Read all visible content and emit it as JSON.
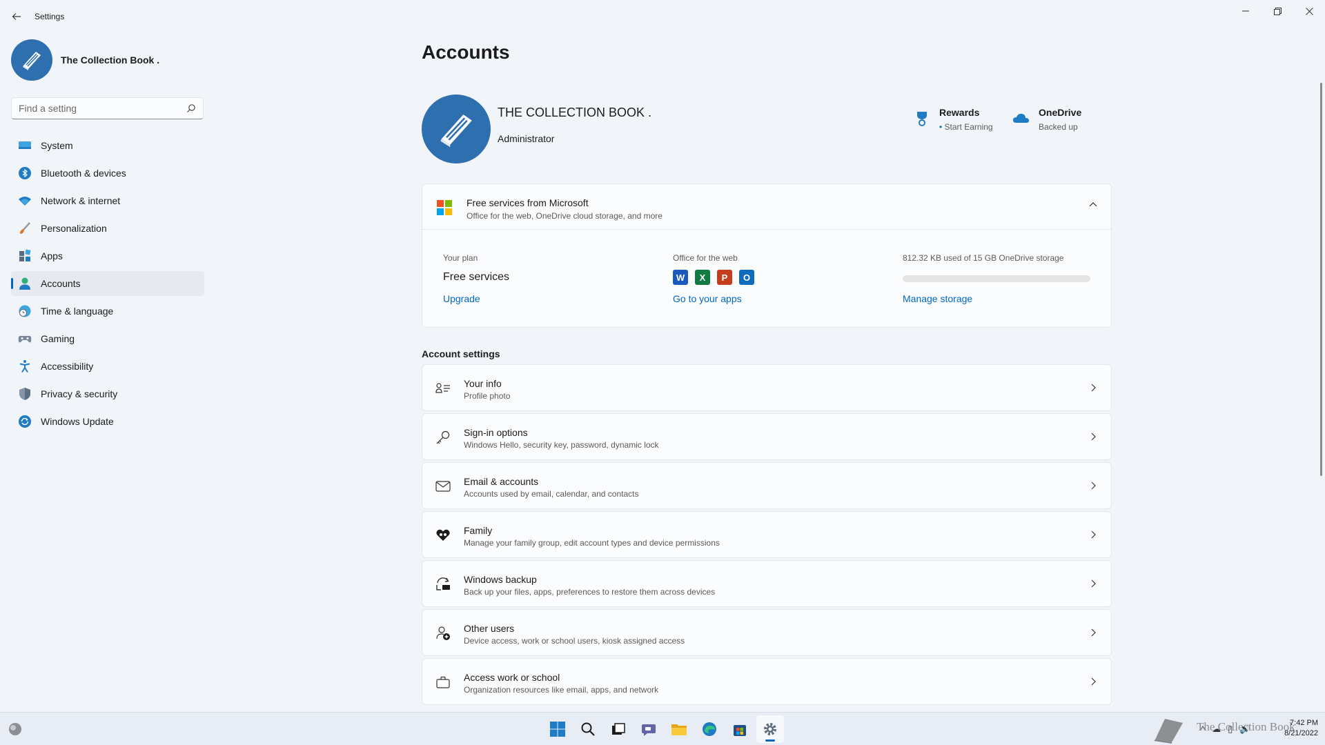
{
  "window": {
    "title": "Settings"
  },
  "profile": {
    "name": "The Collection Book ."
  },
  "search": {
    "placeholder": "Find a setting"
  },
  "nav": [
    {
      "label": "System",
      "icon": "monitor-icon"
    },
    {
      "label": "Bluetooth & devices",
      "icon": "bluetooth-icon"
    },
    {
      "label": "Network & internet",
      "icon": "wifi-icon"
    },
    {
      "label": "Personalization",
      "icon": "brush-icon"
    },
    {
      "label": "Apps",
      "icon": "apps-icon"
    },
    {
      "label": "Accounts",
      "icon": "person-icon",
      "active": true
    },
    {
      "label": "Time & language",
      "icon": "globe-clock-icon"
    },
    {
      "label": "Gaming",
      "icon": "gamepad-icon"
    },
    {
      "label": "Accessibility",
      "icon": "accessibility-icon"
    },
    {
      "label": "Privacy & security",
      "icon": "shield-icon"
    },
    {
      "label": "Windows Update",
      "icon": "update-icon"
    }
  ],
  "main": {
    "page_title": "Accounts",
    "account_name": "THE COLLECTION BOOK .",
    "account_role": "Administrator",
    "rewards": {
      "title": "Rewards",
      "subtitle": "Start Earning"
    },
    "onedrive": {
      "title": "OneDrive",
      "subtitle": "Backed up"
    },
    "free_services": {
      "title": "Free services from Microsoft",
      "subtitle": "Office for the web, OneDrive cloud storage, and more",
      "plan_label": "Your plan",
      "plan_value": "Free services",
      "plan_link": "Upgrade",
      "office_label": "Office for the web",
      "office_link": "Go to your apps",
      "storage_label": "812.32 KB used of 15 GB OneDrive storage",
      "storage_used_fraction": 0.0001,
      "storage_link": "Manage storage",
      "office_apps": [
        {
          "letter": "W",
          "color": "#185abd"
        },
        {
          "letter": "X",
          "color": "#107c41"
        },
        {
          "letter": "P",
          "color": "#c43e1c"
        },
        {
          "letter": "O",
          "color": "#0f6cbd"
        }
      ]
    },
    "section_title": "Account settings",
    "settings": [
      {
        "title": "Your info",
        "subtitle": "Profile photo",
        "icon": "person-card-icon"
      },
      {
        "title": "Sign-in options",
        "subtitle": "Windows Hello, security key, password, dynamic lock",
        "icon": "key-icon"
      },
      {
        "title": "Email & accounts",
        "subtitle": "Accounts used by email, calendar, and contacts",
        "icon": "mail-icon"
      },
      {
        "title": "Family",
        "subtitle": "Manage your family group, edit account types and device permissions",
        "icon": "heart-family-icon"
      },
      {
        "title": "Windows backup",
        "subtitle": "Back up your files, apps, preferences to restore them across devices",
        "icon": "backup-icon"
      },
      {
        "title": "Other users",
        "subtitle": "Device access, work or school users, kiosk assigned access",
        "icon": "add-user-icon"
      },
      {
        "title": "Access work or school",
        "subtitle": "Organization resources like email, apps, and network",
        "icon": "briefcase-icon"
      }
    ]
  },
  "taskbar": {
    "time": "7:42 PM",
    "date": "8/21/2022",
    "watermark_text": "The Collection Book"
  },
  "colors": {
    "accent": "#0067c0",
    "avatar_bg": "#2e6fb0",
    "background": "#f1f4f9"
  }
}
